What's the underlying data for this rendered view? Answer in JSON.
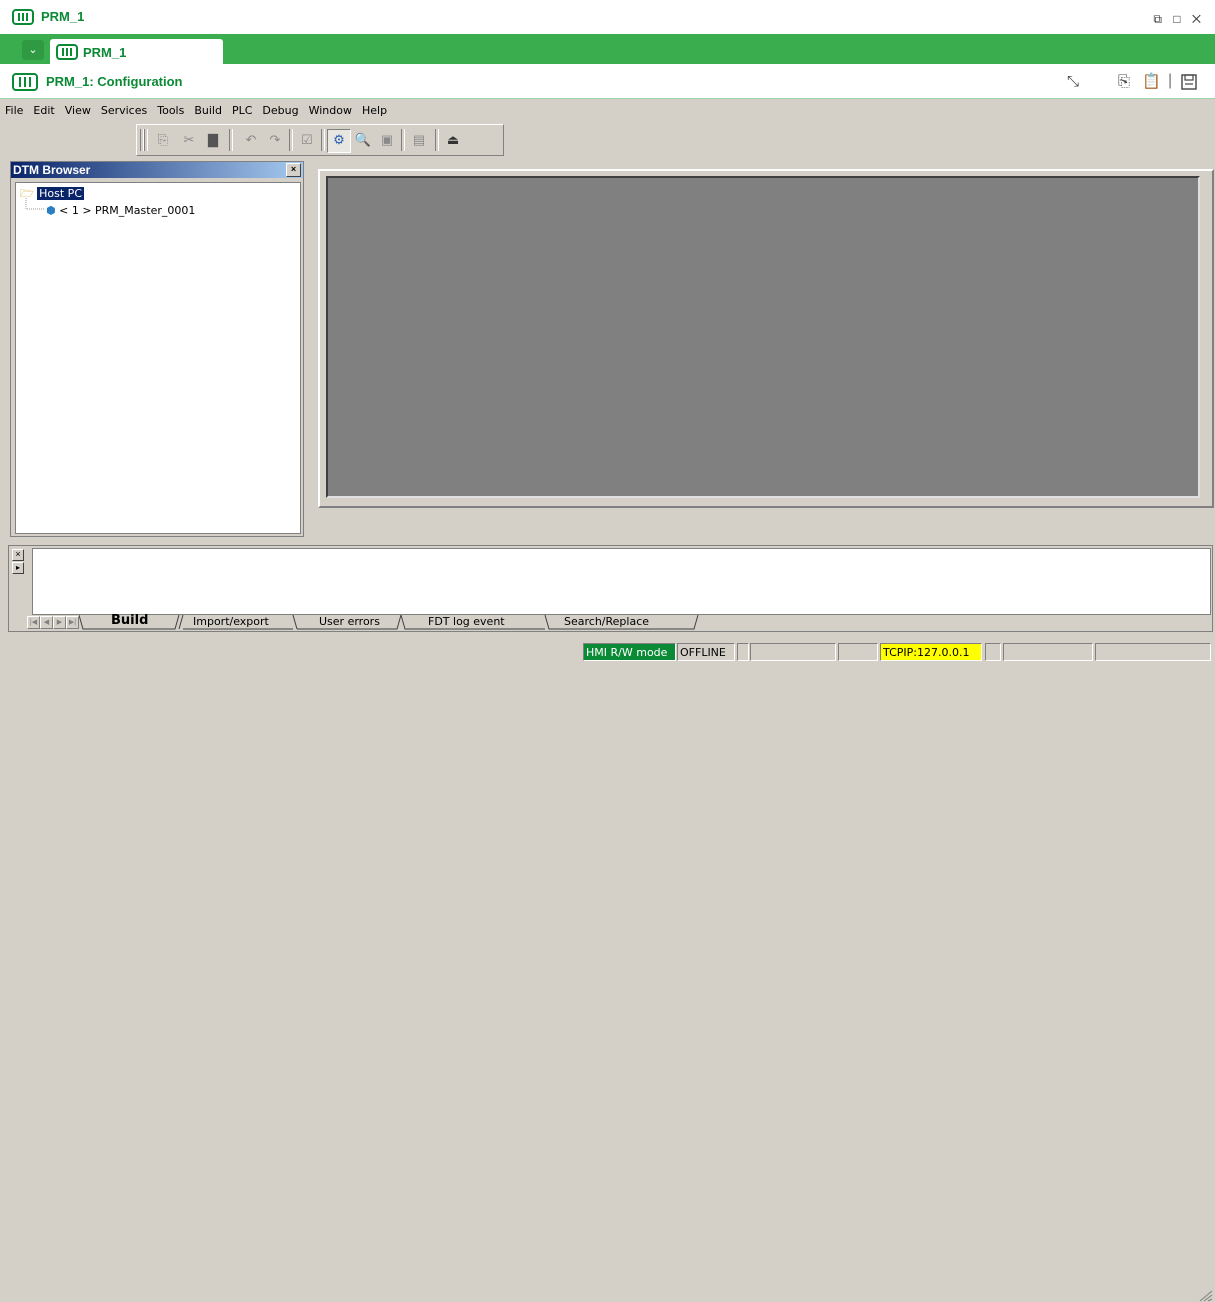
{
  "window": {
    "title": "PRM_1",
    "controls": [
      "⧉",
      "□",
      "✕"
    ]
  },
  "tab": {
    "dropdown_icon": "chevron-down-icon",
    "label": "PRM_1"
  },
  "config_header": {
    "title": "PRM_1: Configuration",
    "icons": [
      "collapse-arrow-icon",
      "copy-icon",
      "paste-icon",
      "save-icon"
    ]
  },
  "menu": {
    "items": [
      "File",
      "Edit",
      "View",
      "Services",
      "Tools",
      "Build",
      "PLC",
      "Debug",
      "Window",
      "Help"
    ]
  },
  "toolbar": {
    "buttons": [
      "copy-icon",
      "cut-icon",
      "paste-icon",
      "undo-icon",
      "redo-icon",
      "check-icon",
      "dtm-config-icon",
      "search-icon",
      "fdt-icon",
      "list-icon",
      "export-icon"
    ]
  },
  "dtm_browser": {
    "title": "DTM Browser",
    "close": "×",
    "root": "Host PC",
    "child": "< 1 > PRM_Master_0001"
  },
  "output": {
    "tabs": [
      "Build",
      "Import/export",
      "User errors",
      "FDT log event",
      "Search/Replace"
    ],
    "active_tab": "Build"
  },
  "status": {
    "mode": "HMI R/W mode",
    "online_state": "OFFLINE",
    "connection": "TCPIP:127.0.0.1",
    "colors": {
      "mode_bg": "#0b8a35",
      "connection_bg": "#ffff00"
    }
  }
}
